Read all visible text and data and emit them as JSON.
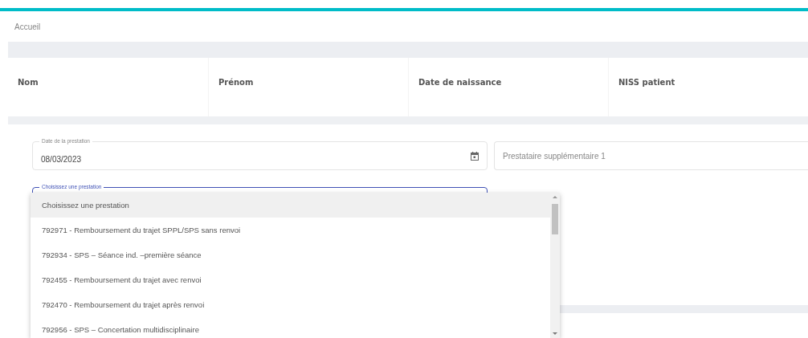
{
  "breadcrumb": "Accueil",
  "patient_table": {
    "columns": [
      "Nom",
      "Prénom",
      "Date de naissance",
      "NISS patient"
    ]
  },
  "form": {
    "date_field": {
      "label": "Date de la prestation",
      "value": "08/03/2023"
    },
    "extra_provider_field": {
      "placeholder": "Prestataire supplémentaire 1"
    },
    "service_select": {
      "label": "Choisissez une prestation",
      "options": [
        {
          "label": "Choisissez une prestation",
          "selected": true
        },
        {
          "label": "792971 - Remboursement du trajet SPPL/SPS sans renvoi",
          "selected": false
        },
        {
          "label": "792934 - SPS – Séance ind. –première séance",
          "selected": false
        },
        {
          "label": "792455 - Remboursement du trajet avec renvoi",
          "selected": false
        },
        {
          "label": "792470 - Remboursement du trajet après renvoi",
          "selected": false
        },
        {
          "label": "792956 - SPS – Concertation multidisciplinaire",
          "selected": false
        }
      ]
    }
  }
}
